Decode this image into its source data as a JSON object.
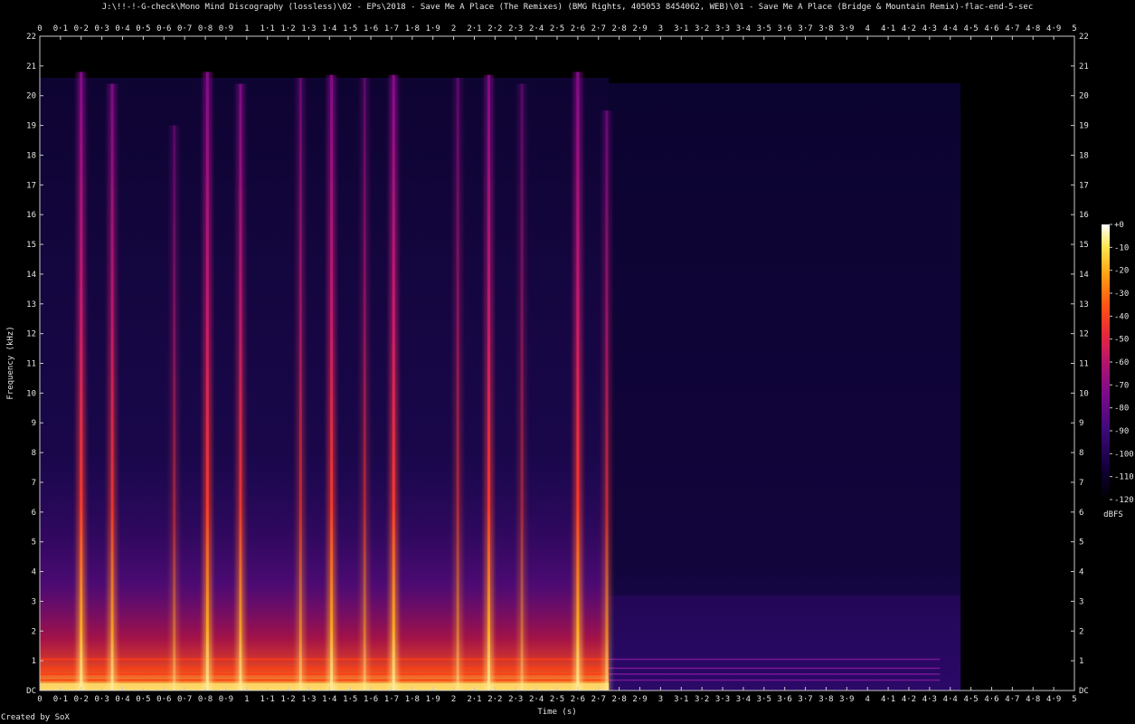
{
  "title": "J:\\!!-!-G-check\\Mono Mind Discography (lossless)\\02 - EPs\\2018 - Save Me A Place (The Remixes) (BMG Rights, 405053 8454062, WEB)\\01 - Save Me A Place (Bridge & Mountain Remix)-flac-end-5-sec",
  "credit": "Created by SoX",
  "colors": {
    "background": "#000000",
    "axis": "#c8c8c8",
    "palette": [
      "#000000",
      "#14003c",
      "#3c0a78",
      "#7a0a8c",
      "#b4146e",
      "#e6283c",
      "#ff5014",
      "#ffa014",
      "#ffe650",
      "#ffffff"
    ]
  },
  "chart_data": {
    "type": "heatmap",
    "xlabel": "Time (s)",
    "ylabel": "Frequency (kHz)",
    "xlim": [
      0,
      5
    ],
    "ylim": [
      0,
      22
    ],
    "x_ticks": [
      "0",
      "0·1",
      "0·2",
      "0·3",
      "0·4",
      "0·5",
      "0·6",
      "0·7",
      "0·8",
      "0·9",
      "1",
      "1·1",
      "1·2",
      "1·3",
      "1·4",
      "1·5",
      "1·6",
      "1·7",
      "1·8",
      "1·9",
      "2",
      "2·1",
      "2·2",
      "2·3",
      "2·4",
      "2·5",
      "2·6",
      "2·7",
      "2·8",
      "2·9",
      "3",
      "3·1",
      "3·2",
      "3·3",
      "3·4",
      "3·5",
      "3·6",
      "3·7",
      "3·8",
      "3·9",
      "4",
      "4·1",
      "4·2",
      "4·3",
      "4·4",
      "4·5",
      "4·6",
      "4·7",
      "4·8",
      "4·9",
      "5"
    ],
    "y_ticks": [
      "DC",
      "1",
      "2",
      "3",
      "4",
      "5",
      "6",
      "7",
      "8",
      "9",
      "10",
      "11",
      "12",
      "13",
      "14",
      "15",
      "16",
      "17",
      "18",
      "19",
      "20",
      "21",
      "22"
    ],
    "colorbar": {
      "label": "dBFS",
      "range": [
        -120,
        0
      ],
      "ticks": [
        "+0",
        "-10",
        "-20",
        "-30",
        "-40",
        "-50",
        "-60",
        "-70",
        "-80",
        "-90",
        "-100",
        "-110",
        "-120"
      ]
    },
    "signal_end_s": 2.75,
    "noise_end_s": 4.45,
    "cutoff_khz": 20.6,
    "transients": [
      {
        "t": 0.2,
        "top_khz": 20.8,
        "level": 1.0
      },
      {
        "t": 0.35,
        "top_khz": 20.4,
        "level": 0.85
      },
      {
        "t": 0.65,
        "top_khz": 19.0,
        "level": 0.45
      },
      {
        "t": 0.81,
        "top_khz": 20.8,
        "level": 1.0
      },
      {
        "t": 0.97,
        "top_khz": 20.4,
        "level": 0.85
      },
      {
        "t": 1.26,
        "top_khz": 20.6,
        "level": 0.6
      },
      {
        "t": 1.41,
        "top_khz": 20.7,
        "level": 0.95
      },
      {
        "t": 1.57,
        "top_khz": 20.6,
        "level": 0.5
      },
      {
        "t": 1.71,
        "top_khz": 20.7,
        "level": 1.0
      },
      {
        "t": 2.02,
        "top_khz": 20.6,
        "level": 0.5
      },
      {
        "t": 2.17,
        "top_khz": 20.7,
        "level": 0.95
      },
      {
        "t": 2.33,
        "top_khz": 20.4,
        "level": 0.45
      },
      {
        "t": 2.6,
        "top_khz": 20.8,
        "level": 1.0
      },
      {
        "t": 2.74,
        "top_khz": 19.5,
        "level": 0.6
      }
    ],
    "tonal_lines_khz": [
      0.35,
      0.55,
      0.75,
      1.05
    ]
  }
}
